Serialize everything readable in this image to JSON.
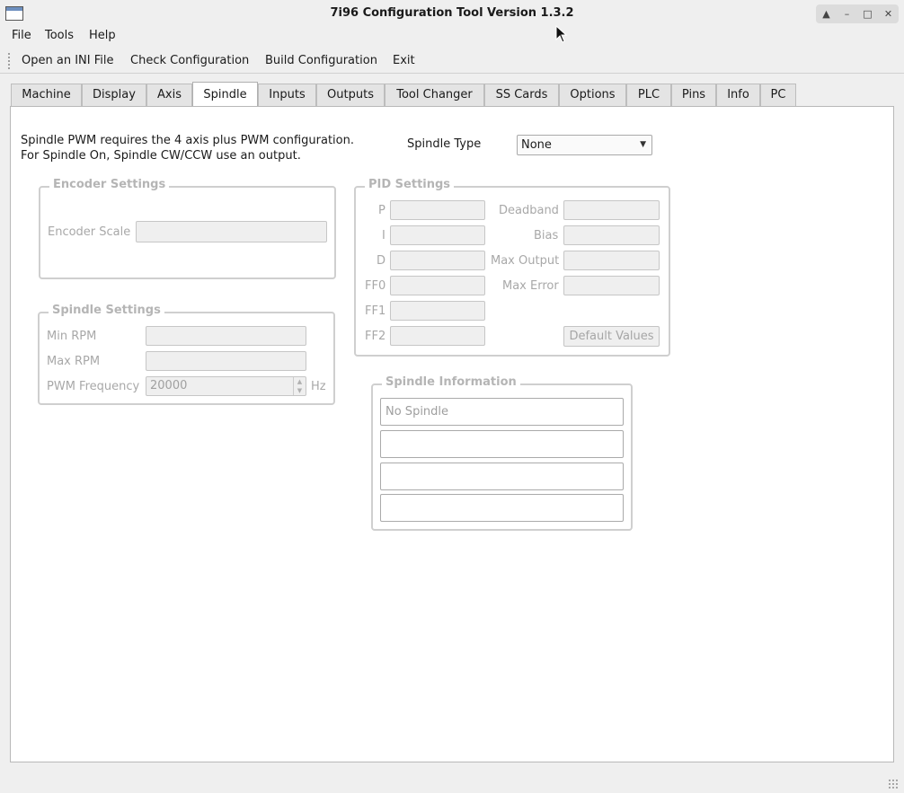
{
  "window": {
    "title": "7i96 Configuration Tool Version 1.3.2"
  },
  "menu": [
    "File",
    "Tools",
    "Help"
  ],
  "toolbar": [
    "Open an INI File",
    "Check Configuration",
    "Build Configuration",
    "Exit"
  ],
  "tabs": [
    "Machine",
    "Display",
    "Axis",
    "Spindle",
    "Inputs",
    "Outputs",
    "Tool Changer",
    "SS Cards",
    "Options",
    "PLC",
    "Pins",
    "Info",
    "PC"
  ],
  "active_tab": "Spindle",
  "spindle": {
    "info_line1": "Spindle PWM requires the 4 axis plus PWM configuration.",
    "info_line2": "For Spindle On, Spindle CW/CCW use an output.",
    "type_label": "Spindle Type",
    "type_value": "None"
  },
  "encoder": {
    "title": "Encoder Settings",
    "scale_label": "Encoder Scale",
    "scale_value": ""
  },
  "spindle_settings": {
    "title": "Spindle Settings",
    "min_rpm_label": "Min RPM",
    "max_rpm_label": "Max RPM",
    "pwm_label": "PWM Frequency",
    "pwm_value": "20000",
    "pwm_unit": "Hz"
  },
  "pid": {
    "title": "PID Settings",
    "p": "P",
    "i": "I",
    "d": "D",
    "ff0": "FF0",
    "ff1": "FF1",
    "ff2": "FF2",
    "deadband": "Deadband",
    "bias": "Bias",
    "max_output": "Max Output",
    "max_error": "Max Error",
    "default_button": "Default Values"
  },
  "spindle_info": {
    "title": "Spindle Information",
    "lines": [
      "No Spindle",
      "",
      "",
      ""
    ]
  },
  "icons": {
    "app": "app-window-icon",
    "shade": "shade-icon",
    "minimize": "minimize-icon",
    "maximize": "maximize-icon",
    "close": "close-icon"
  }
}
